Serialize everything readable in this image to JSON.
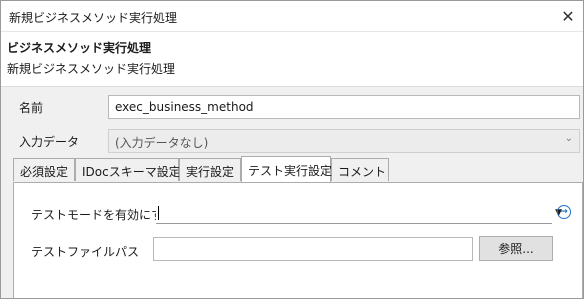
{
  "window": {
    "title": "新規ビジネスメソッド実行処理",
    "close_glyph": "✕"
  },
  "header": {
    "title": "ビジネスメソッド実行処理",
    "description": "新規ビジネスメソッド実行処理"
  },
  "form": {
    "name_label": "名前",
    "name_value": "exec_business_method",
    "input_data_label": "入力データ",
    "input_data_value": "(入力データなし)"
  },
  "tabs": [
    {
      "label": "必須設定",
      "active": false
    },
    {
      "label": "IDocスキーマ設定",
      "active": false
    },
    {
      "label": "実行設定",
      "active": false
    },
    {
      "label": "テスト実行設定",
      "active": true
    },
    {
      "label": "コメント",
      "active": false
    }
  ],
  "test_panel": {
    "test_mode_label": "テストモードを有効にする",
    "test_mode_value": "",
    "test_file_label": "テストファイルパス",
    "test_file_value": "",
    "browse_label": "参照..."
  },
  "icons": {
    "close": "close-icon",
    "dropdown": "chevron-down-icon",
    "navigate": "arrow-circle-right-icon"
  },
  "colors": {
    "accent": "#1e73c8",
    "window_bg": "#f0f0f0",
    "panel_bg": "#ffffff"
  }
}
